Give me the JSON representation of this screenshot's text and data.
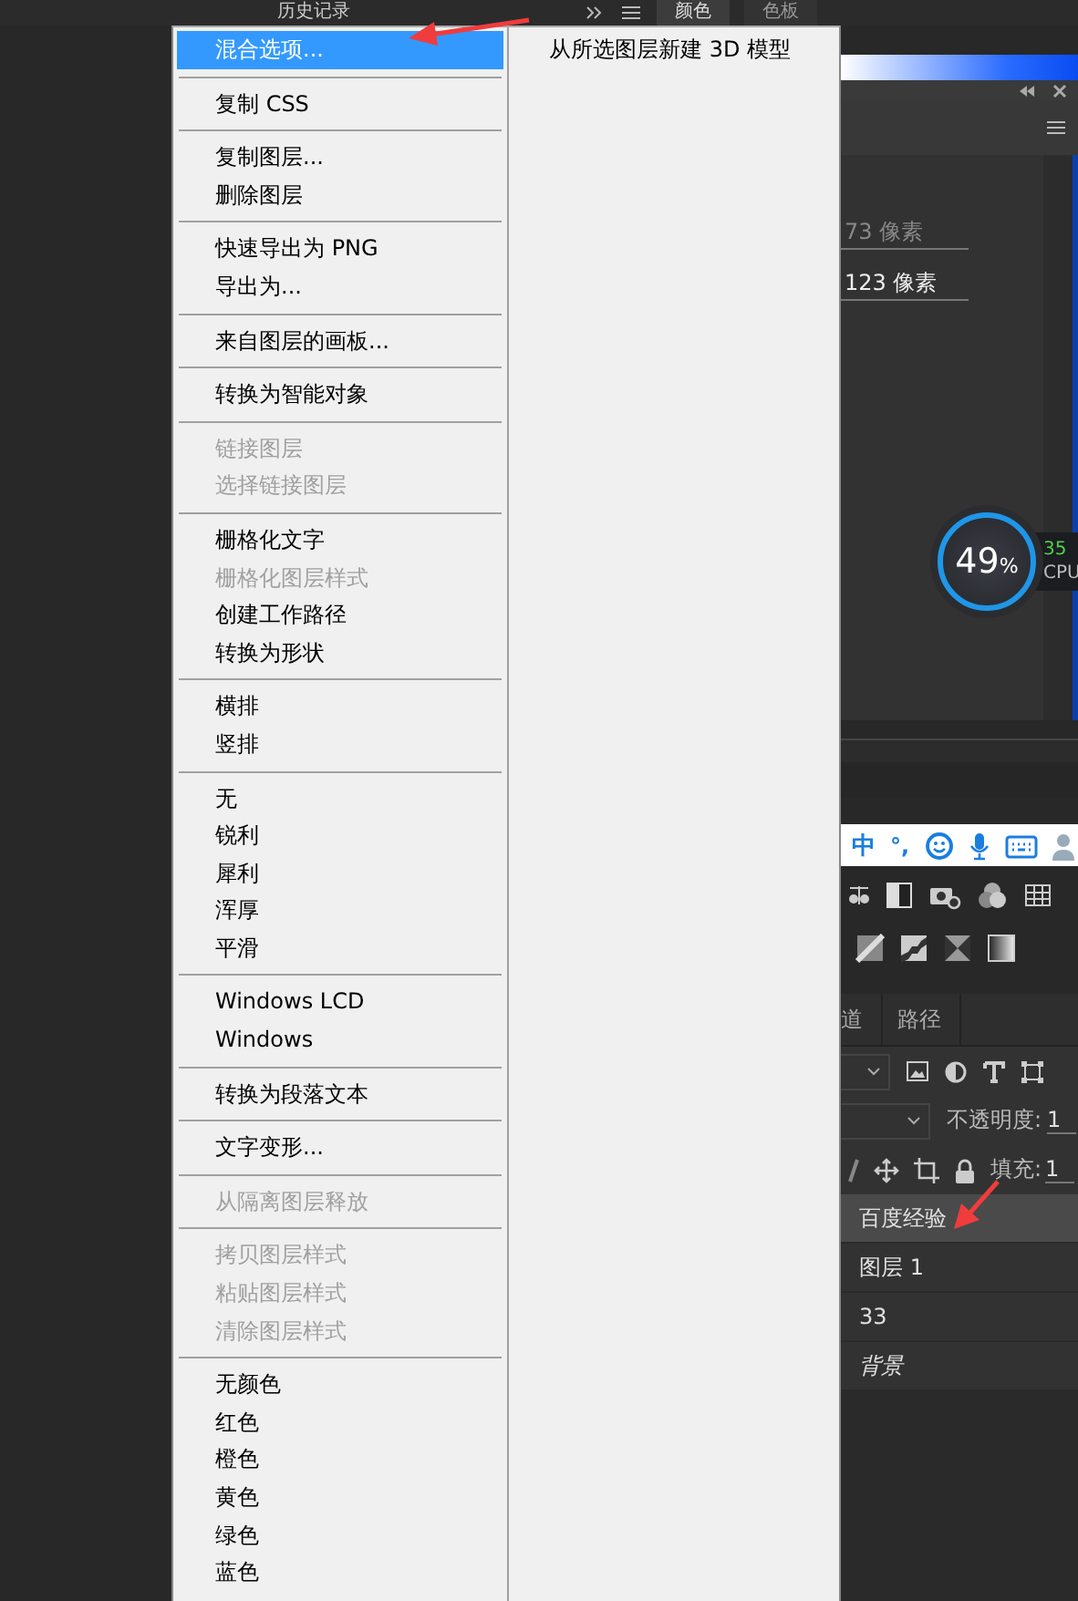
{
  "top_bar": {
    "history_tab": "历史记录",
    "tabs": [
      {
        "label": "颜色",
        "selected": true
      },
      {
        "label": "色板",
        "selected": false
      }
    ]
  },
  "menu": {
    "groups": [
      {
        "items": [
          {
            "label": "混合选项...",
            "disabled": false,
            "selected": true
          }
        ]
      },
      {
        "items": [
          {
            "label": "复制 CSS",
            "disabled": false,
            "selected": false
          }
        ]
      },
      {
        "items": [
          {
            "label": "复制图层...",
            "disabled": false,
            "selected": false
          },
          {
            "label": "删除图层",
            "disabled": false,
            "selected": false
          }
        ]
      },
      {
        "items": [
          {
            "label": "快速导出为 PNG",
            "disabled": false,
            "selected": false
          },
          {
            "label": "导出为...",
            "disabled": false,
            "selected": false
          }
        ]
      },
      {
        "items": [
          {
            "label": "来自图层的画板...",
            "disabled": false,
            "selected": false
          }
        ]
      },
      {
        "items": [
          {
            "label": "转换为智能对象",
            "disabled": false,
            "selected": false
          }
        ]
      },
      {
        "items": [
          {
            "label": "链接图层",
            "disabled": true,
            "selected": false
          },
          {
            "label": "选择链接图层",
            "disabled": true,
            "selected": false
          }
        ]
      },
      {
        "items": [
          {
            "label": "栅格化文字",
            "disabled": false,
            "selected": false
          },
          {
            "label": "栅格化图层样式",
            "disabled": true,
            "selected": false
          },
          {
            "label": "创建工作路径",
            "disabled": false,
            "selected": false
          },
          {
            "label": "转换为形状",
            "disabled": false,
            "selected": false
          }
        ]
      },
      {
        "items": [
          {
            "label": "横排",
            "disabled": false,
            "selected": false
          },
          {
            "label": "竖排",
            "disabled": false,
            "selected": false
          }
        ]
      },
      {
        "items": [
          {
            "label": "无",
            "disabled": false,
            "selected": false
          },
          {
            "label": "锐利",
            "disabled": false,
            "selected": false
          },
          {
            "label": "犀利",
            "disabled": false,
            "selected": false
          },
          {
            "label": "浑厚",
            "disabled": false,
            "selected": false
          },
          {
            "label": "平滑",
            "disabled": false,
            "selected": false
          }
        ]
      },
      {
        "items": [
          {
            "label": "Windows LCD",
            "disabled": false,
            "selected": false
          },
          {
            "label": "Windows",
            "disabled": false,
            "selected": false
          }
        ]
      },
      {
        "items": [
          {
            "label": "转换为段落文本",
            "disabled": false,
            "selected": false
          }
        ]
      },
      {
        "items": [
          {
            "label": "文字变形...",
            "disabled": false,
            "selected": false
          }
        ]
      },
      {
        "items": [
          {
            "label": "从隔离图层释放",
            "disabled": true,
            "selected": false
          }
        ]
      },
      {
        "items": [
          {
            "label": "拷贝图层样式",
            "disabled": true,
            "selected": false
          },
          {
            "label": "粘贴图层样式",
            "disabled": true,
            "selected": false
          },
          {
            "label": "清除图层样式",
            "disabled": true,
            "selected": false
          }
        ]
      },
      {
        "items": [
          {
            "label": "无颜色",
            "disabled": false,
            "selected": false
          },
          {
            "label": "红色",
            "disabled": false,
            "selected": false
          },
          {
            "label": "橙色",
            "disabled": false,
            "selected": false
          },
          {
            "label": "黄色",
            "disabled": false,
            "selected": false
          },
          {
            "label": "绿色",
            "disabled": false,
            "selected": false
          },
          {
            "label": "蓝色",
            "disabled": false,
            "selected": false
          }
        ]
      }
    ]
  },
  "submenu": {
    "items": [
      {
        "label": "从所选图层新建 3D 模型",
        "disabled": false
      }
    ]
  },
  "properties": {
    "fields": [
      {
        "value": "73 像素",
        "disabled": true
      },
      {
        "value": "123 像素",
        "disabled": false
      }
    ]
  },
  "cpu_widget": {
    "percent": "49",
    "unit": "%",
    "temperature": "35",
    "label": "CPU"
  },
  "ime_bar": {
    "mode": "中",
    "punctuation": "°,"
  },
  "layers_panel": {
    "tabs": [
      {
        "label": "道",
        "selected": false
      },
      {
        "label": "路径",
        "selected": false
      }
    ],
    "opacity_label": "不透明度:",
    "opacity_value": "1",
    "fill_label": "填充:",
    "fill_value": "1",
    "layers": [
      {
        "name": "百度经验",
        "kind": "text",
        "selected": true
      },
      {
        "name": "图层 1",
        "kind": "normal",
        "selected": false
      },
      {
        "name": "33",
        "kind": "text",
        "selected": false
      },
      {
        "name": "背景",
        "kind": "background",
        "selected": false
      }
    ]
  }
}
